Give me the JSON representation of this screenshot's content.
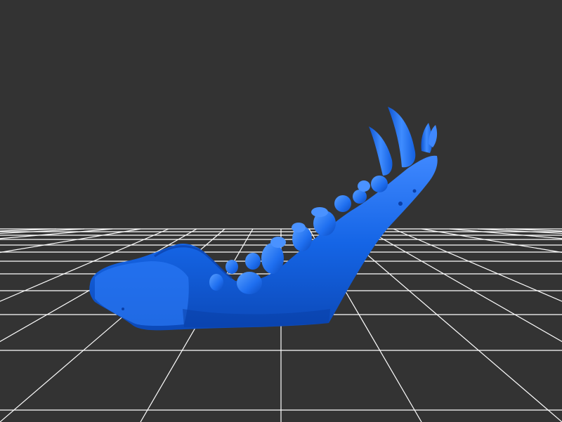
{
  "scene": {
    "background_color": "#333333",
    "grid_color": "#ffffff",
    "model_color": "#1565e6",
    "model_highlight_color": "#4a92ff",
    "model_shadow_color": "#0a3fa8",
    "model_subject": "mandible-with-teeth",
    "grid_visible": true
  }
}
